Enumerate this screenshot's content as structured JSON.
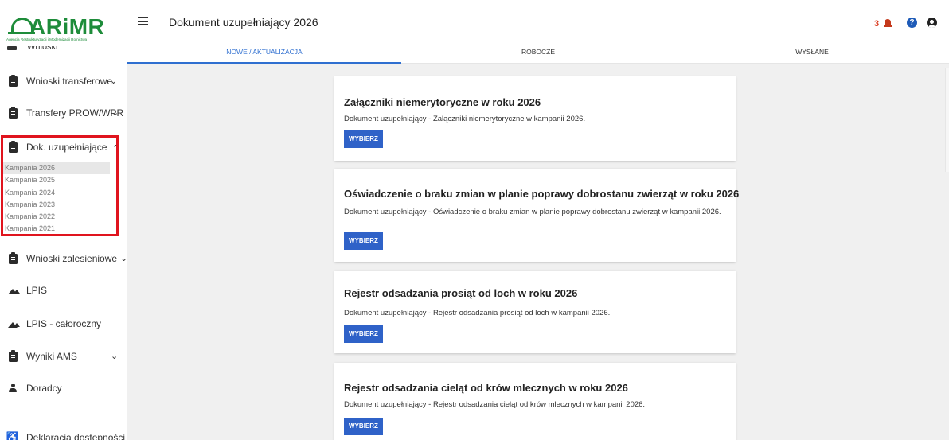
{
  "logo": {
    "name": "ARiMR",
    "subtitle": "Agencja Restrukturyzacji i Modernizacji Rolnictwa"
  },
  "sidebar": {
    "partial_item": "Wnioski",
    "items": [
      {
        "label": "Wnioski transferowe",
        "icon": "clipboard-icon",
        "chevron": "⌄"
      },
      {
        "label": "Transfery PROW/WPR",
        "icon": "clipboard-icon",
        "chevron": "⌄"
      },
      {
        "label": "Dok. uzupełniające",
        "icon": "clipboard-icon",
        "chevron": "⌃"
      },
      {
        "label": "Wnioski zalesieniowe",
        "icon": "clipboard-icon",
        "chevron": "⌄"
      },
      {
        "label": "LPIS",
        "icon": "mountain-icon"
      },
      {
        "label": "LPIS - całoroczny",
        "icon": "mountain-icon"
      },
      {
        "label": "Wyniki AMS",
        "icon": "clipboard-icon",
        "chevron": "⌄"
      },
      {
        "label": "Doradcy",
        "icon": "person-icon"
      },
      {
        "label": "Deklaracja dostępności",
        "icon": "accessibility-icon"
      }
    ],
    "submenu": [
      "Kampania 2026",
      "Kampania 2025",
      "Kampania 2024",
      "Kampania 2023",
      "Kampania 2022",
      "Kampania 2021"
    ],
    "submenu_active": "Kampania 2026",
    "highlight_color": "#e0141e"
  },
  "header": {
    "menu_icon": "≡",
    "title": "Dokument uzupełniający 2026",
    "notification_count": "3",
    "help": "?",
    "colors": {
      "notification": "#d9361a",
      "help": "#1e5bb8"
    }
  },
  "tabs": [
    {
      "label": "NOWE / AKTUALIZACJA",
      "active": true
    },
    {
      "label": "ROBOCZE",
      "active": false
    },
    {
      "label": "WYSŁANE",
      "active": false
    }
  ],
  "cards": [
    {
      "title": "Załączniki niemerytoryczne w roku 2026",
      "description": "Dokument uzupełniający - Załączniki niemerytoryczne w kampanii 2026.",
      "button": "WYBIERZ"
    },
    {
      "title": "Oświadczenie o braku zmian w planie poprawy dobrostanu zwierząt w roku 2026",
      "description": "Dokument uzupełniający - Oświadczenie o braku zmian w planie poprawy dobrostanu zwierząt w kampanii 2026.",
      "button": "WYBIERZ"
    },
    {
      "title": "Rejestr odsadzania prosiąt od loch w roku 2026",
      "description": "Dokument uzupełniający - Rejestr odsadzania prosiąt od loch w kampanii 2026.",
      "button": "WYBIERZ"
    },
    {
      "title": "Rejestr odsadzania cieląt od krów mlecznych w roku 2026",
      "description": "Dokument uzupełniający - Rejestr odsadzania cieląt od krów mlecznych w kampanii 2026.",
      "button": "WYBIERZ"
    }
  ],
  "accent_color": "#2f62c8",
  "brand_color": "#1e8c3a"
}
